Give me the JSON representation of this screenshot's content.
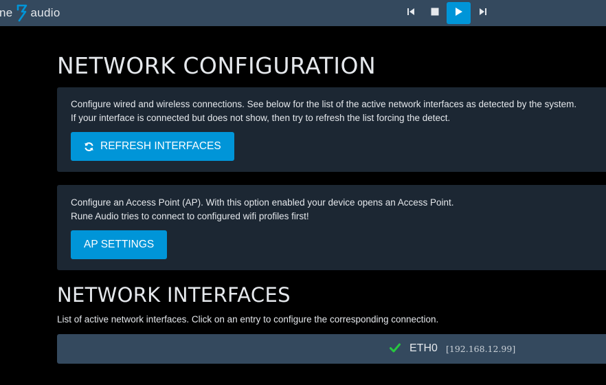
{
  "colors": {
    "topbar_bg": "#34495e",
    "accent": "#0095d8",
    "panel_bg": "#1c2733",
    "row_bg": "#34495e",
    "check_green": "#27c93f"
  },
  "header": {
    "logo_left": "ne",
    "logo_right": "audio",
    "logo_icon": "rune-logo-icon",
    "controls": [
      {
        "name": "previous-icon"
      },
      {
        "name": "stop-icon"
      },
      {
        "name": "play-icon",
        "active": true
      },
      {
        "name": "next-icon"
      }
    ]
  },
  "main": {
    "title": "NETWORK CONFIGURATION",
    "refresh_panel": {
      "line1": "Configure wired and wireless connections. See below for the list of the active network interfaces as detected by the system.",
      "line2": "If your interface is connected but does not show, then try to refresh the list forcing the detect.",
      "button_label": "REFRESH INTERFACES",
      "button_icon": "refresh-icon"
    },
    "ap_panel": {
      "line1": "Configure an Access Point (AP). With this option enabled your device opens an Access Point.",
      "line2": "Rune Audio tries to connect to configured wifi profiles first!",
      "button_label": "AP SETTINGS"
    },
    "interfaces_title": "NETWORK INTERFACES",
    "interfaces_desc": "List of active network interfaces. Click on an entry to configure the corresponding connection.",
    "interfaces": [
      {
        "name": "ETH0",
        "ip": "[192.168.12.99]",
        "status_icon": "check-icon"
      }
    ]
  }
}
